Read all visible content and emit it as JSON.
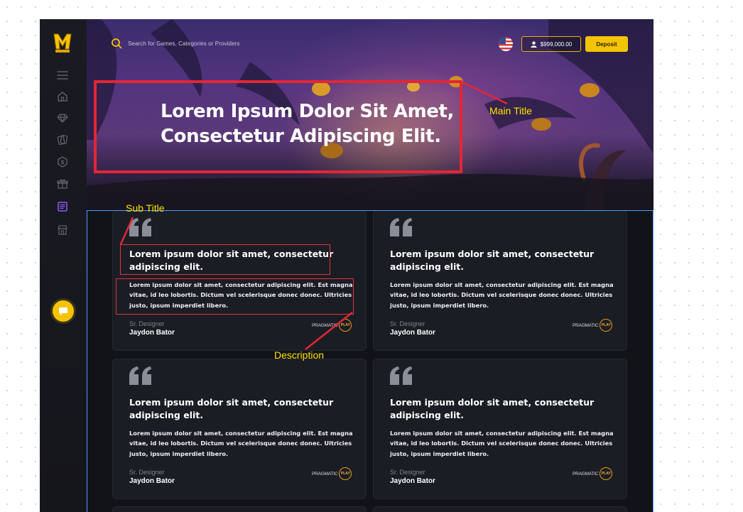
{
  "topbar": {
    "search_placeholder": "Search for Games, Categories or Providers",
    "balance": "$999,000.00",
    "deposit_label": "Deposit"
  },
  "hero": {
    "title_line1": "Lorem Ipsum Dolor Sit Amet,",
    "title_line2": "Consectetur Adipiscing Elit."
  },
  "sidebar": {
    "items": [
      "menu-icon",
      "home-icon",
      "diamond-icon",
      "cards-icon",
      "coin-icon",
      "gift-icon",
      "news-icon",
      "store-icon"
    ],
    "active_item": "news-icon",
    "accent": "#f5c400",
    "active_color": "#8a5cf6"
  },
  "annotations": {
    "main_title": "Main Title",
    "sub_title": "Sub Title",
    "description": "Description"
  },
  "testimonials": [
    {
      "title": "Lorem ipsum dolor sit amet, consectetur adipiscing elit.",
      "description": "Lorem ipsum dolor sit amet, consectetur adipiscing elit. Est magna vitae, id leo lobortis. Dictum vel scelerisque donec donec. Ultricies justo, ipsum imperdiet libero.",
      "role": "Sr. Designer",
      "author": "Jaydon Bator",
      "provider": "PRAGMATIC",
      "provider_badge": "PLAY"
    },
    {
      "title": "Lorem ipsum dolor sit amet, consectetur adipiscing elit.",
      "description": "Lorem ipsum dolor sit amet, consectetur adipiscing elit. Est magna vitae, id leo lobortis. Dictum vel scelerisque donec donec. Ultricies justo, ipsum imperdiet libero.",
      "role": "Sr. Designer",
      "author": "Jaydon Bator",
      "provider": "PRAGMATIC",
      "provider_badge": "PLAY"
    },
    {
      "title": "Lorem ipsum dolor sit amet, consectetur adipiscing elit.",
      "description": "Lorem ipsum dolor sit amet, consectetur adipiscing elit. Est magna vitae, id leo lobortis. Dictum vel scelerisque donec donec. Ultricies justo, ipsum imperdiet libero.",
      "role": "Sr. Designer",
      "author": "Jaydon Bator",
      "provider": "PRAGMATIC",
      "provider_badge": "PLAY"
    },
    {
      "title": "Lorem ipsum dolor sit amet, consectetur adipiscing elit.",
      "description": "Lorem ipsum dolor sit amet, consectetur adipiscing elit. Est magna vitae, id leo lobortis. Dictum vel scelerisque donec donec. Ultricies justo, ipsum imperdiet libero.",
      "role": "Sr. Designer",
      "author": "Jaydon Bator",
      "provider": "PRAGMATIC",
      "provider_badge": "PLAY"
    }
  ]
}
